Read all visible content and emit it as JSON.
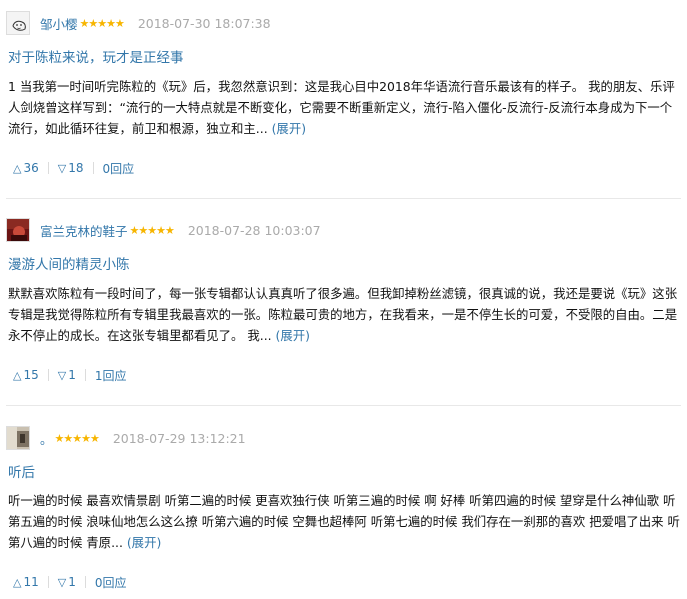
{
  "reviews": [
    {
      "user": "邹小樱",
      "rating_stars": "★★★★★",
      "rating": 5,
      "time": "2018-07-30 18:07:38",
      "title": "对于陈粒来说，玩才是正经事",
      "content": "1 当我第一时间听完陈粒的《玩》后，我忽然意识到：这是我心目中2018年华语流行音乐最该有的样子。 我的朋友、乐评人剑烧曾这样写到：“流行的一大特点就是不断变化，它需要不断重新定义，流行-陷入僵化-反流行-反流行本身成为下一个流行，如此循环往复，前卫和根源，独立和主...",
      "expand": "(展开)",
      "up": "36",
      "down": "18",
      "replies": "0回应"
    },
    {
      "user": "富兰克林的鞋子",
      "rating_stars": "★★★★★",
      "rating": 5,
      "time": "2018-07-28 10:03:07",
      "title": "漫游人间的精灵小陈",
      "content": "默默喜欢陈粒有一段时间了，每一张专辑都认认真真听了很多遍。但我卸掉粉丝滤镜，很真诚的说，我还是要说《玩》这张专辑是我觉得陈粒所有专辑里我最喜欢的一张。陈粒最可贵的地方，在我看来，一是不停生长的可爱，不受限的自由。二是永不停止的成长。在这张专辑里都看见了。 我...",
      "expand": "(展开)",
      "up": "15",
      "down": "1",
      "replies": "1回应"
    },
    {
      "user": "。",
      "rating_stars": "★★★★★",
      "rating": 5,
      "time": "2018-07-29 13:12:21",
      "title": "听后",
      "content": "听一遍的时候 最喜欢情景剧 听第二遍的时候 更喜欢独行侠 听第三遍的时候 啊 好棒 听第四遍的时候 望穿是什么神仙歌 听第五遍的时候 浪味仙地怎么这么撩 听第六遍的时候 空舞也超棒阿 听第七遍的时候 我们存在一刹那的喜欢 把爱唱了出来 听第八遍的时候 青原...",
      "expand": "(展开)",
      "up": "11",
      "down": "1",
      "replies": "0回应"
    }
  ],
  "icons": {
    "upvote": "△",
    "downvote": "▽"
  },
  "colors": {
    "link": "#3377aa",
    "star": "#f7b500",
    "timestamp": "#aaaaaa"
  }
}
